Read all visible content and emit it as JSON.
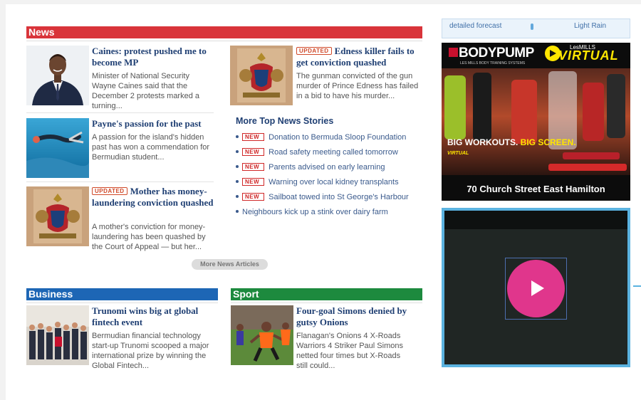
{
  "news": {
    "header": "News",
    "stories": [
      {
        "tag": "",
        "title": "Caines: protest pushed me to become MP",
        "body": "Minister of National Security Wayne Caines said that the December 2 protests marked a turning..."
      },
      {
        "tag": "UPDATED",
        "title": "Edness killer fails to get conviction quashed",
        "body": "The gunman convicted of the gun murder of Prince Edness has failed in a bid to have his murder..."
      },
      {
        "tag": "",
        "title": "Payne's passion for the past",
        "body": "A passion for the island's hidden past has won a commendation for Bermudian student..."
      },
      {
        "tag": "UPDATED",
        "title": "Mother has money-laundering conviction quashed",
        "body": "A mother's conviction for money-laundering has been quashed by the Court of Appeal — but her..."
      }
    ],
    "more_top_heading": "More Top News Stories",
    "new_label": "NEW",
    "top_list": [
      {
        "new": true,
        "text": "Donation to Bermuda Sloop Foundation"
      },
      {
        "new": true,
        "text": "Road safety meeting called tomorrow"
      },
      {
        "new": true,
        "text": "Parents advised on early learning"
      },
      {
        "new": true,
        "text": "Warning over local kidney transplants"
      },
      {
        "new": true,
        "text": "Sailboat towed into St George's Harbour"
      },
      {
        "new": false,
        "text": "Neighbours kick up a stink over dairy farm"
      }
    ],
    "more_button": "More News Articles"
  },
  "business": {
    "header": "Business",
    "title": "Trunomi wins big at global fintech event",
    "body": "Bermudian financial technology start-up Trunomi scooped a major international prize by winning the Global Fintech..."
  },
  "sport": {
    "header": "Sport",
    "title": "Four-goal Simons denied by gutsy Onions",
    "body": "Flanagan's Onions 4 X-Roads Warriors 4 Striker Paul Simons netted four times but X-Roads still could..."
  },
  "weather": {
    "left": "detailed forecast",
    "right": "Light Rain"
  },
  "ad": {
    "brand": "BODYPUMP",
    "brand_sub": "LES MILLS BODY TRAINING SYSTEMS",
    "lesmills": "LesMILLS",
    "virtual": "VIRTUAL",
    "tagline_a": "BIG WORKOUTS.",
    "tagline_b": "BIG SCREEN.",
    "small_virtual": "VIRTUAL",
    "address": "70 Church Street East Hamilton"
  },
  "colors": {
    "news": "#d9343a",
    "business": "#1d66b5",
    "sport": "#1d8a3e",
    "link": "#1f3f73",
    "video_border": "#5bb3e0",
    "play": "#e0368c"
  },
  "icons": [
    "play-icon",
    "rain-icon",
    "bullet-icon"
  ]
}
